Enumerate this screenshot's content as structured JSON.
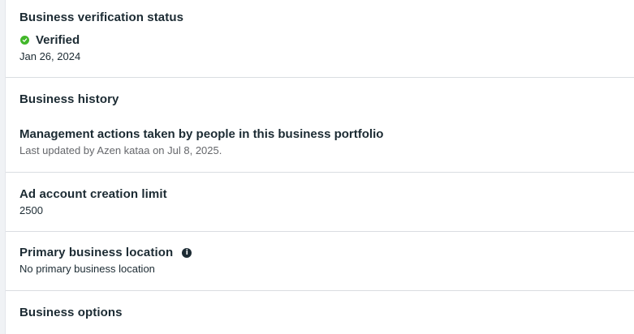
{
  "verification": {
    "title": "Business verification status",
    "status_icon": "check-circle-icon",
    "status": "Verified",
    "date": "Jan 26, 2024"
  },
  "history": {
    "title": "Business history",
    "management_title": "Management actions taken by people in this business portfolio",
    "last_updated": "Last updated by Azen kataa on Jul 8, 2025."
  },
  "ad_limit": {
    "title": "Ad account creation limit",
    "value": "2500"
  },
  "location": {
    "title": "Primary business location",
    "info_icon": "info-icon",
    "value": "No primary business location"
  },
  "options": {
    "title": "Business options"
  },
  "colors": {
    "verified_green": "#42b72a",
    "divider": "#dadde1",
    "text_primary": "#1c2b33",
    "text_secondary": "#65676b"
  }
}
